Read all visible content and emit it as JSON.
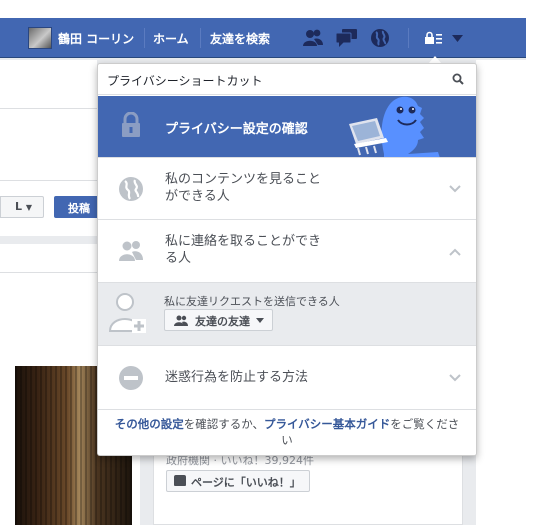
{
  "topbar": {
    "user_name": "鶴田 コーリン",
    "home_label": "ホーム",
    "find_friends_label": "友達を検索",
    "icons": [
      "friend-requests-icon",
      "messages-icon",
      "notifications-globe-icon",
      "privacy-shortcuts-icon",
      "account-menu-icon"
    ]
  },
  "dropdown": {
    "title": "プライバシーショートカット",
    "checkup_label": "プライバシー設定の確認",
    "rows": [
      {
        "label_line1": "私のコンテンツを見ること",
        "label_line2": "ができる人",
        "icon": "globe-icon",
        "state": "collapsed"
      },
      {
        "label_line1": "私に連絡を取ることができ",
        "label_line2": "る人",
        "icon": "friends-icon",
        "state": "expanded"
      },
      {
        "label_line1": "迷惑行為を防止する方法",
        "label_line2": "",
        "icon": "block-icon",
        "state": "collapsed"
      }
    ],
    "expanded": {
      "text": "私に友達リクエストを送信できる人",
      "select_value": "友達の友達"
    },
    "footer": {
      "link1": "その他の設定",
      "mid": "を確認するか、",
      "link2": "プライバシー基本ガイド",
      "end_line1": "をご覧くださ",
      "end_line2": "い"
    }
  },
  "background": {
    "audience_select": "L",
    "post_button": "投稿",
    "page_meta": "政府機関 · いいね！39,924件",
    "like_page_button": "ページに「いいね！」"
  },
  "colors": {
    "brand_blue": "#4267b2",
    "link_blue": "#365899",
    "panel_gray": "#e9ebee"
  }
}
